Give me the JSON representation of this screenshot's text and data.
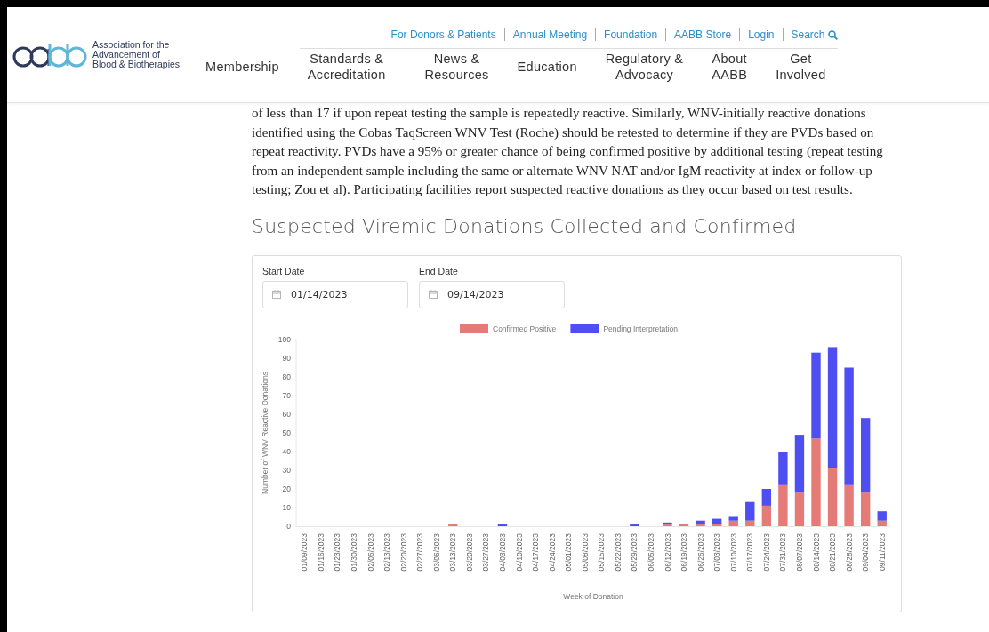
{
  "header": {
    "logo_text": [
      "Association for the",
      "Advancement of",
      "Blood & Biotherapies"
    ],
    "utility_links": [
      "For Donors & Patients",
      "Annual Meeting",
      "Foundation",
      "AABB Store",
      "Login",
      "Search"
    ],
    "nav": [
      [
        "Membership"
      ],
      [
        "Standards &",
        "Accreditation"
      ],
      [
        "News &",
        "Resources"
      ],
      [
        "Education"
      ],
      [
        "Regulatory &",
        "Advocacy"
      ],
      [
        "About",
        "AABB"
      ],
      [
        "Get",
        "Involved"
      ]
    ]
  },
  "paragraph": "of less than 17 if upon repeat testing the sample is repeatedly reactive. Similarly, WNV-initially reactive donations identified using the Cobas TaqScreen WNV Test (Roche) should be retested to determine if they are PVDs based on repeat reactivity. PVDs have a 95% or greater chance of being confirmed positive by additional testing (repeat testing from an independent sample including the same or alternate WNV NAT and/or IgM reactivity at index or follow-up testing; Zou et al). Participating facilities report suspected reactive donations as they occur based on test results.",
  "heading": "Suspected Viremic Donations Collected and Confirmed",
  "filters": [
    {
      "label": "Start Date",
      "value": "01/14/2023"
    },
    {
      "label": "End Date",
      "value": "09/14/2023"
    }
  ],
  "chart_data": {
    "type": "bar",
    "stacked": true,
    "legend": true,
    "xlabel": "Week of Donation",
    "ylabel": "Number of WNV Reactive Donations",
    "ylim": [
      0,
      100
    ],
    "yticks": [
      0,
      10,
      20,
      30,
      40,
      50,
      60,
      70,
      80,
      90,
      100
    ],
    "categories": [
      "01/09/2023",
      "01/16/2023",
      "01/23/2023",
      "01/30/2023",
      "02/06/2023",
      "02/13/2023",
      "02/20/2023",
      "02/27/2023",
      "03/06/2023",
      "03/13/2023",
      "03/20/2023",
      "03/27/2023",
      "04/03/2023",
      "04/10/2023",
      "04/17/2023",
      "04/24/2023",
      "05/01/2023",
      "05/08/2023",
      "05/15/2023",
      "05/22/2023",
      "05/29/2023",
      "06/05/2023",
      "06/12/2023",
      "06/19/2023",
      "06/26/2023",
      "07/03/2023",
      "07/10/2023",
      "07/17/2023",
      "07/24/2023",
      "07/31/2023",
      "08/07/2023",
      "08/14/2023",
      "08/21/2023",
      "08/28/2023",
      "09/04/2023",
      "09/11/2023"
    ],
    "series": [
      {
        "name": "Confirmed Positive",
        "color": "#e57b77",
        "values": [
          0,
          0,
          0,
          0,
          0,
          0,
          0,
          0,
          0,
          1,
          0,
          0,
          0,
          0,
          0,
          0,
          0,
          0,
          0,
          0,
          0,
          0,
          1,
          1,
          1,
          1,
          3,
          3,
          11,
          22,
          18,
          47,
          31,
          22,
          18,
          3
        ]
      },
      {
        "name": "Pending Interpretation",
        "color": "#4f4ef0",
        "values": [
          0,
          0,
          0,
          0,
          0,
          0,
          0,
          0,
          0,
          0,
          0,
          0,
          1,
          0,
          0,
          0,
          0,
          0,
          0,
          0,
          1,
          0,
          1,
          0,
          2,
          3,
          2,
          10,
          9,
          18,
          31,
          46,
          65,
          63,
          40,
          5
        ]
      }
    ]
  }
}
